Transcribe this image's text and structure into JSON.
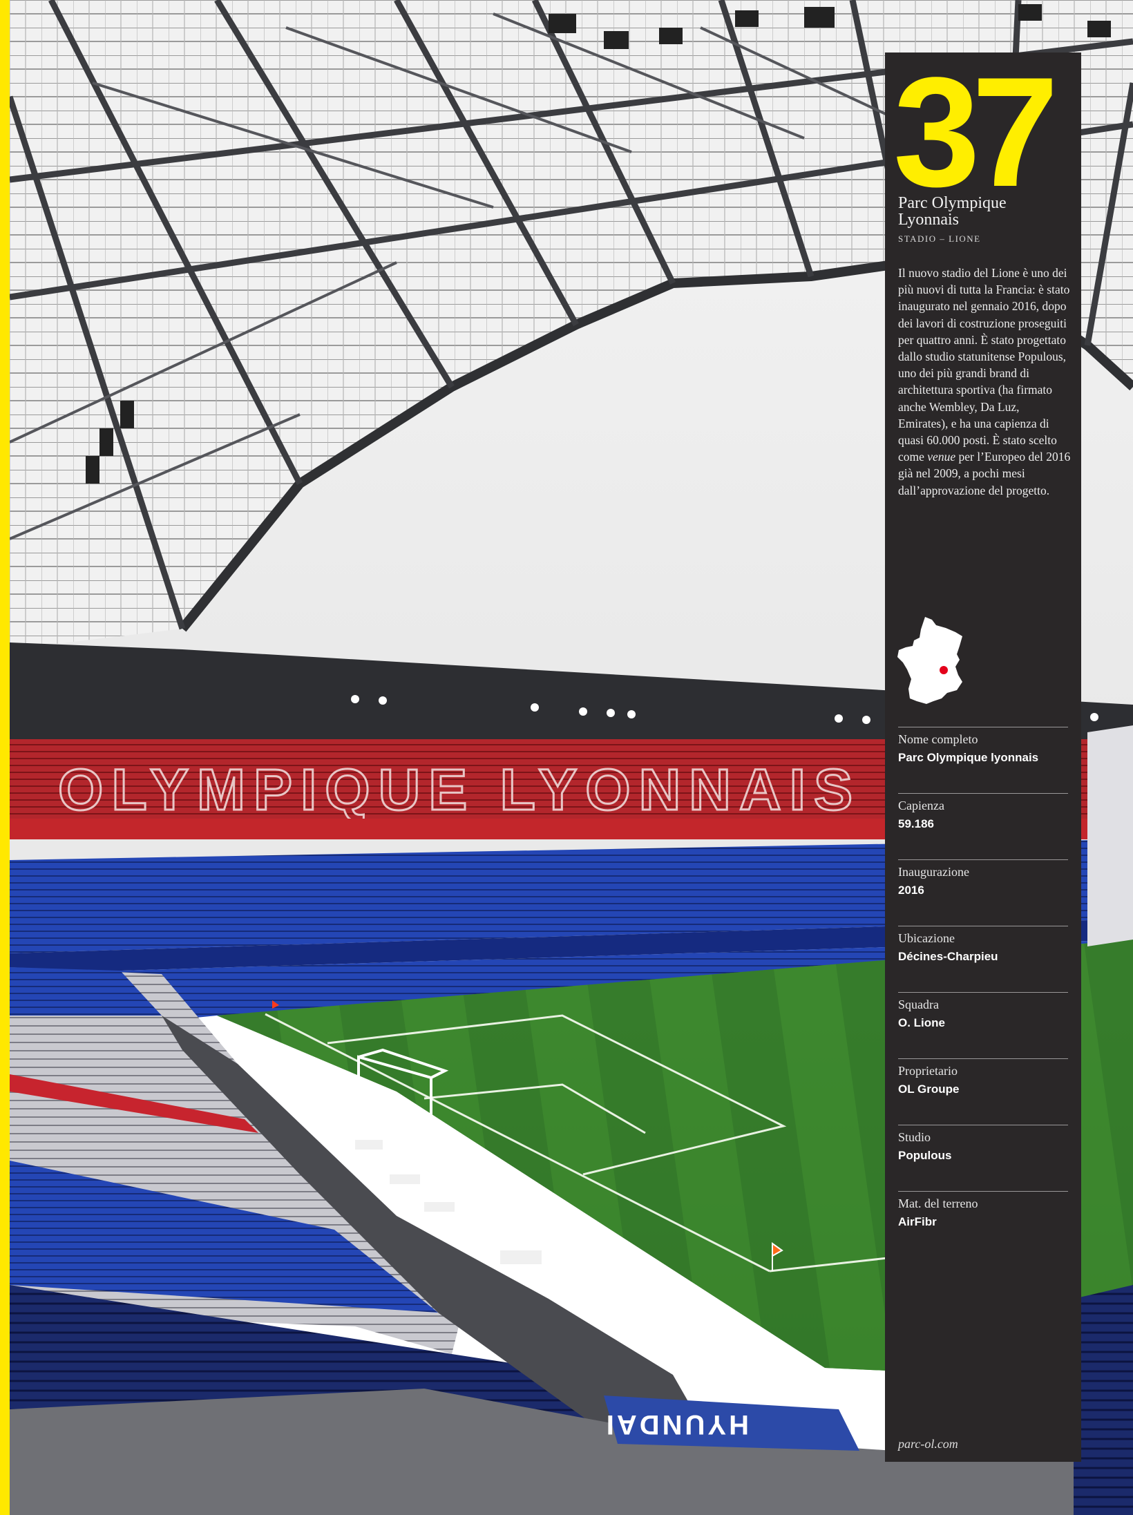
{
  "entry": {
    "number": "37",
    "title": "Parc Olympique Lyonnais",
    "subtitle": "STADIO – LIONE",
    "description_before_italic": "Il nuovo stadio del Lione è uno dei più nuovi di tutta la Francia: è stato inaugurato nel gennaio 2016, dopo dei lavori di costruzione proseguiti per quattro anni. È stato progettato dallo studio statunitense Populous, uno dei più grandi brand di architettura sportiva (ha firmato anche Wembley, Da Luz, Emirates), e ha una capienza di quasi 60.000 posti. È stato scelto come ",
    "description_italic": "venue",
    "description_after_italic": " per l’Europeo del 2016 già nel 2009, a pochi mesi dall’approvazione del progetto.",
    "url": "parc-ol.com"
  },
  "facts": [
    {
      "label": "Nome completo",
      "value": "Parc Olympique lyonnais"
    },
    {
      "label": "Capienza",
      "value": "59.186"
    },
    {
      "label": "Inaugurazione",
      "value": "2016"
    },
    {
      "label": "Ubicazione",
      "value": "Décines-Charpieu"
    },
    {
      "label": "Squadra",
      "value": "O. Lione"
    },
    {
      "label": "Proprietario",
      "value": "OL Groupe"
    },
    {
      "label": "Studio",
      "value": "Populous"
    },
    {
      "label": "Mat. del terreno",
      "value": "AirFibr"
    }
  ],
  "photo": {
    "stand_lettering": "OLYMPIQUE LYONNAIS",
    "banner_lettering": "HYUNDAI"
  },
  "colors": {
    "accent_yellow": "#ffee00",
    "panel_bg": "#2a2728",
    "map_marker": "#e3001b"
  },
  "icons": {
    "map": "france-map-icon"
  }
}
